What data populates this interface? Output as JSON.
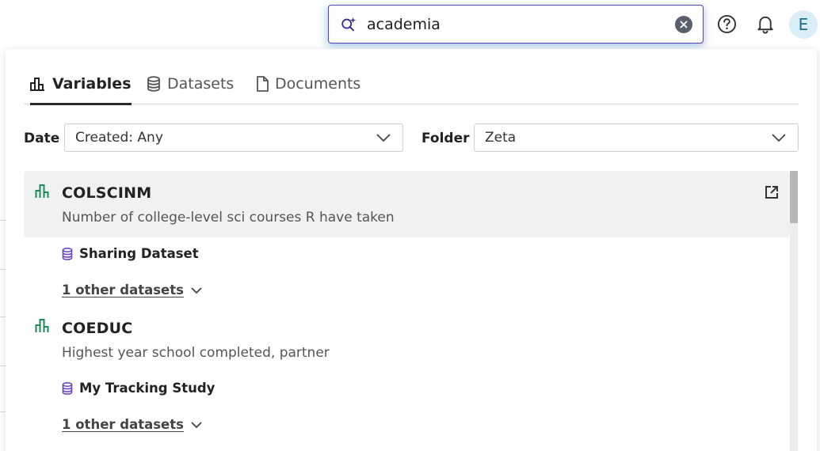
{
  "search": {
    "value": "academia"
  },
  "header": {
    "avatar_initial": "E"
  },
  "tabs": [
    {
      "label": "Variables",
      "icon": "bar-chart-icon",
      "active": true
    },
    {
      "label": "Datasets",
      "icon": "database-icon",
      "active": false
    },
    {
      "label": "Documents",
      "icon": "document-icon",
      "active": false
    }
  ],
  "filters": {
    "date_label": "Date",
    "date_value": "Created: Any",
    "folder_label": "Folder",
    "folder_value": "Zeta"
  },
  "results": [
    {
      "name": "COLSCINM",
      "description": "Number of college-level sci courses R have taken",
      "dataset": "Sharing Dataset",
      "more": "1 other datasets"
    },
    {
      "name": "COEDUC",
      "description": "Highest year school completed, partner",
      "dataset": "My Tracking Study",
      "more": "1 other datasets"
    }
  ],
  "colors": {
    "accent": "#5b3fb3",
    "variable_icon": "#1e8a5a",
    "dataset_icon": "#6a45c2"
  }
}
